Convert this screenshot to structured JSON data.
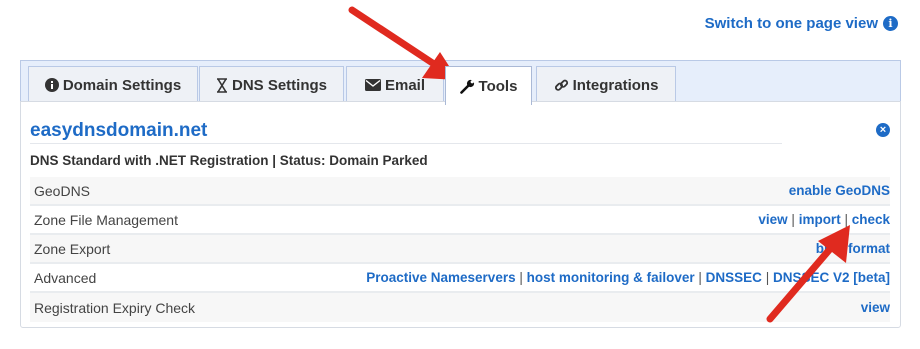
{
  "switch_link": "Switch to one page view",
  "info_glyph": "i",
  "tabs": [
    {
      "label": "Domain Settings",
      "icon": "info-circle-icon",
      "active": false
    },
    {
      "label": "DNS Settings",
      "icon": "hourglass-icon",
      "active": false
    },
    {
      "label": "Email",
      "icon": "envelope-icon",
      "active": false
    },
    {
      "label": "Tools",
      "icon": "wrench-icon",
      "active": true
    },
    {
      "label": "Integrations",
      "icon": "link-icon",
      "active": false
    }
  ],
  "panel": {
    "domain": "easydnsdomain.net",
    "status": "DNS Standard with .NET Registration | Status: Domain Parked",
    "close_glyph": "×"
  },
  "rows": [
    {
      "label": "GeoDNS",
      "links": [
        "enable GeoDNS"
      ]
    },
    {
      "label": "Zone File Management",
      "links": [
        "view",
        "import",
        "check"
      ]
    },
    {
      "label": "Zone Export",
      "links": [
        "bind format"
      ]
    },
    {
      "label": "Advanced",
      "links": [
        "Proactive Nameservers",
        "host monitoring & failover",
        "DNSSEC",
        "DNSSEC V2 [beta]"
      ]
    },
    {
      "label": "Registration Expiry Check",
      "links": [
        "view"
      ]
    }
  ],
  "colors": {
    "accent": "#1e6bc6",
    "arrow": "#e02a1f"
  }
}
